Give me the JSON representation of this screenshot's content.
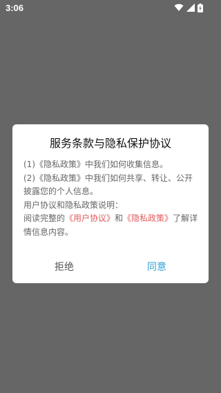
{
  "status_bar": {
    "time": "3:06",
    "icons": [
      "wifi-icon",
      "cellular-signal-icon",
      "battery-charging-icon"
    ]
  },
  "dialog": {
    "title": "服务条款与隐私保护协议",
    "line1": "(1)《隐私政策》中我们如何收集信息。",
    "line2": "(2)《隐私政策》中我们如何共享、转让、公开披露您的个人信息。",
    "line3": "用户协议和隐私政策说明：",
    "line4_prefix": "阅读完整的",
    "user_agreement_link": "《用户协议》",
    "and_text": "和",
    "privacy_policy_link": "《隐私政策》",
    "line4_suffix": "了解详情信息内容。",
    "reject_label": "拒绝",
    "agree_label": "同意"
  },
  "colors": {
    "overlay": "#666666",
    "dialog_bg": "#ffffff",
    "link": "#e25a5a",
    "agree": "#2ea3d6"
  }
}
